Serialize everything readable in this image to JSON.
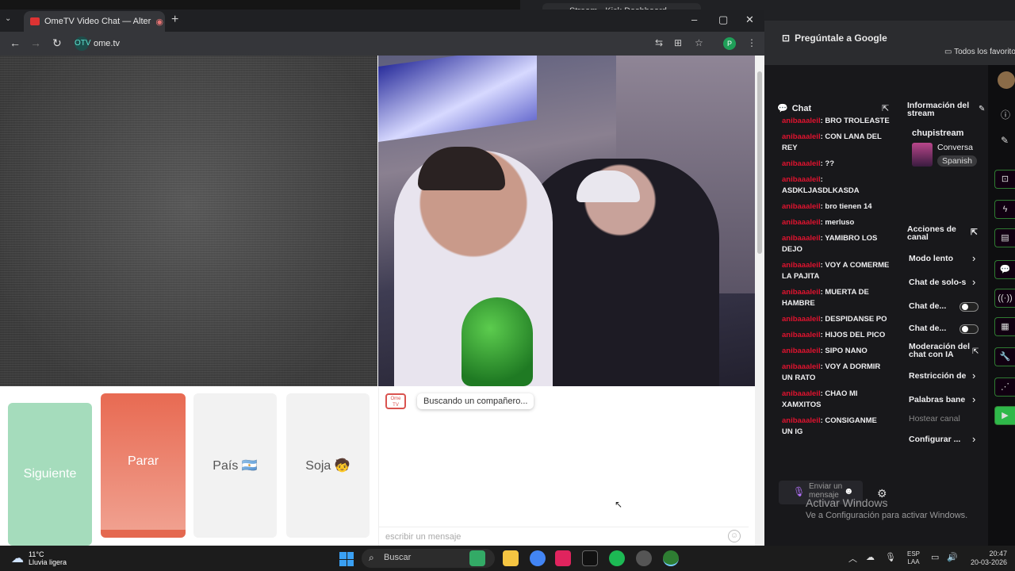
{
  "front_window": {
    "tab_title": "OmeTV Video Chat — Alter",
    "url": "ome.tv",
    "site_icon": "OTV"
  },
  "ometv": {
    "buttons": {
      "next": "Siguiente",
      "stop": "Parar",
      "country": "País 🇦🇷",
      "gender": "Soja 🧒"
    },
    "bot_label": "Ome TV",
    "status_message": "Buscando un compañero...",
    "message_placeholder": "escribir un mensaje"
  },
  "back_window": {
    "tab_title": "Stream - Kick Dashboard",
    "ask_google": "Pregúntale a Google",
    "bookmarks": "Todos los favorito"
  },
  "chat": {
    "title": "Chat",
    "messages": [
      {
        "user": "anibaaaleil",
        "text": ": BRO TROLEASTE"
      },
      {
        "user": "anibaaaleil",
        "text": ": CON LANA DEL REY"
      },
      {
        "user": "anibaaaleil",
        "text": ": ??"
      },
      {
        "user": "anibaaaleil",
        "text": ": ASDKLJASDLKASDA"
      },
      {
        "user": "anibaaaleil",
        "text": ": bro tienen 14"
      },
      {
        "user": "anibaaaleil",
        "text": ": merluso"
      },
      {
        "user": "anibaaaleil",
        "text": ": YAMIBRO LOS DEJO"
      },
      {
        "user": "anibaaaleil",
        "text": ": VOY A COMERME LA PAJITA"
      },
      {
        "user": "anibaaaleil",
        "text": ": MUERTA DE HAMBRE"
      },
      {
        "user": "anibaaaleil",
        "text": ": DESPIDANSE PO"
      },
      {
        "user": "anibaaaleil",
        "text": ": HIJOS DEL PICO"
      },
      {
        "user": "anibaaaleil",
        "text": ": SIPO NANO"
      },
      {
        "user": "anibaaaleil",
        "text": ": VOY A DORMIR UN RATO"
      },
      {
        "user": "anibaaaleil",
        "text": ": CHAO MI XAMXITOS"
      },
      {
        "user": "anibaaaleil",
        "text": ": CONSIGANME UN IG"
      }
    ],
    "input_placeholder": "Enviar un mensaje"
  },
  "stream_info": {
    "title": "Información del stream",
    "channel": "chupistream",
    "category": "Conversa",
    "language": "Spanish"
  },
  "channel_actions": {
    "title": "Acciones de canal",
    "items": [
      {
        "label": "Modo lento",
        "kind": "arrow"
      },
      {
        "label": "Chat de solo-s",
        "kind": "arrow"
      },
      {
        "label": "Chat de...",
        "kind": "toggle"
      },
      {
        "label": "Chat de...",
        "kind": "toggle"
      },
      {
        "label": "Moderación del chat con IA",
        "kind": "external"
      },
      {
        "label": "Restricción de",
        "kind": "arrow"
      },
      {
        "label": "Palabras bane",
        "kind": "arrow"
      },
      {
        "label": "Hostear canal",
        "kind": "disabled"
      },
      {
        "label": "Configurar ...",
        "kind": "arrow"
      }
    ]
  },
  "activation": {
    "title": "Activar Windows",
    "subtitle": "Ve a Configuración para activar Windows."
  },
  "taskbar": {
    "temperature": "11°C",
    "weather": "Lluvia ligera",
    "search": "Buscar",
    "lang_top": "ESP",
    "lang_bottom": "LAA",
    "time": "20:47",
    "date": "20-03-2026"
  },
  "colors": {
    "kick_green": "#53fc18",
    "chat_user": "#e0132f",
    "next_button": "#a5dcbc",
    "stop_button": "#e86a52"
  }
}
